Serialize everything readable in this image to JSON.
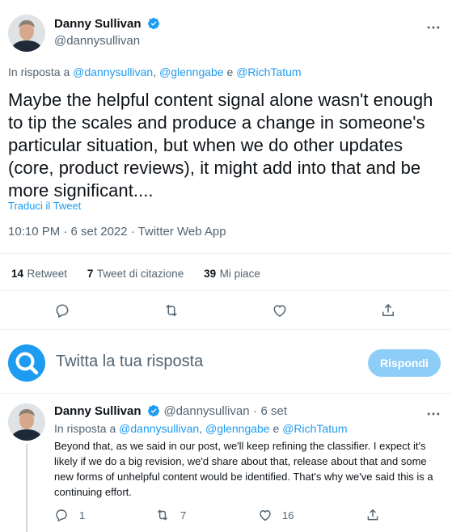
{
  "tweet": {
    "author_name": "Danny Sullivan",
    "author_handle": "@dannysullivan",
    "reply_prefix": "In risposta a",
    "reply_user1": "@dannysullivan",
    "reply_user2": "@glenngabe",
    "reply_and": "e",
    "reply_user3": "@RichTatum",
    "text": "Maybe the helpful content signal alone wasn't enough to tip the scales and produce a change in someone's particular situation, but when we do other updates (core, product reviews), it might add into that and be more significant....",
    "translate_label": "Traduci il Tweet",
    "timestamp": "10:10 PM · 6 set 2022 · Twitter Web App",
    "stats": {
      "retweets_count": "14",
      "retweets_label": "Retweet",
      "quotes_count": "7",
      "quotes_label": "Tweet di citazione",
      "likes_count": "39",
      "likes_label": "Mi piace"
    }
  },
  "composer": {
    "placeholder": "Twitta la tua risposta",
    "reply_button": "Rispondi"
  },
  "reply": {
    "author_name": "Danny Sullivan",
    "author_handle": "@dannysullivan",
    "dot": "·",
    "date": "6 set",
    "reply_prefix": "In risposta a",
    "reply_user1": "@dannysullivan",
    "reply_user2": "@glenngabe",
    "reply_and": "e",
    "reply_user3": "@RichTatum",
    "text": "Beyond that, as we said in our post, we'll keep refining the classifier. I expect it's likely if we do a big revision, we'd share about that, release about that and some new forms of unhelpful content would be identified. That's why we've said this is a continuing effort.",
    "replies": "1",
    "retweets": "7",
    "likes": "16"
  },
  "colors": {
    "accent": "#1d9bf0",
    "secondary_text": "#536471",
    "button_disabled": "#8ecdf7"
  },
  "icons": [
    "avatar",
    "verified-badge-icon",
    "reply-icon",
    "retweet-icon",
    "like-icon",
    "share-icon",
    "search-icon"
  ]
}
